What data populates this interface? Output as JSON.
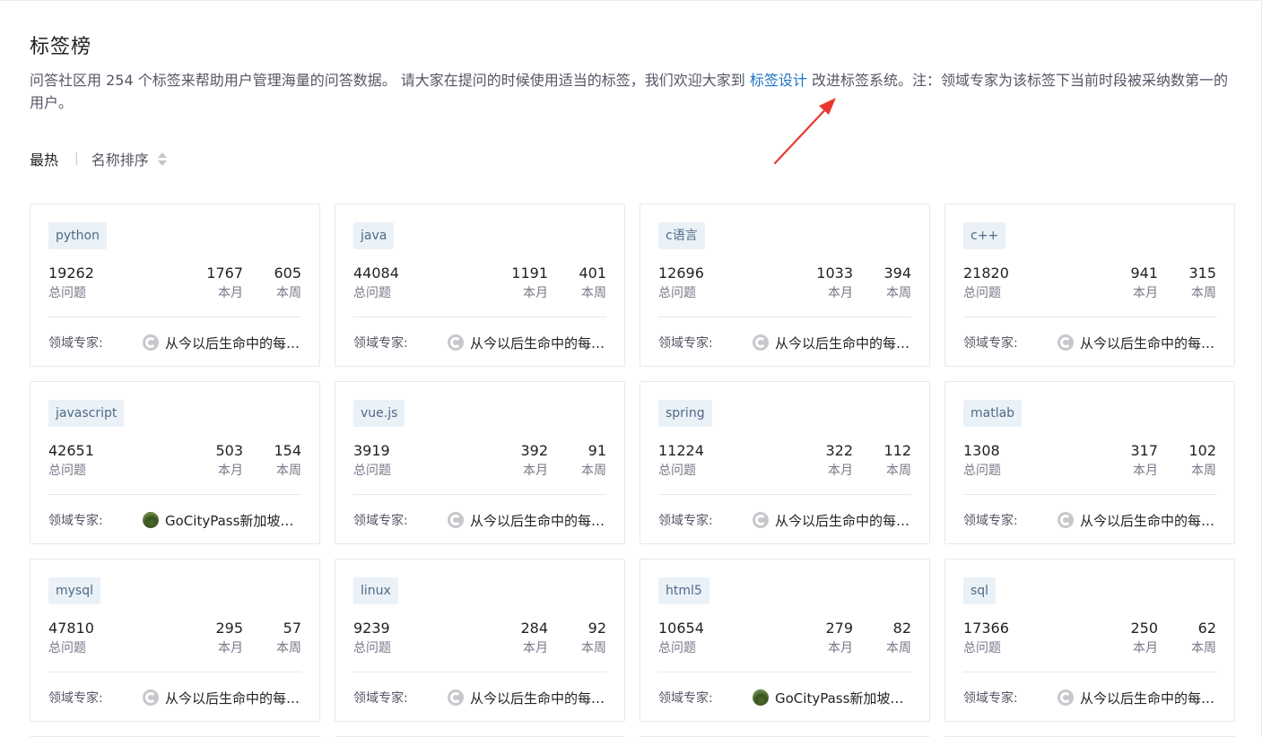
{
  "page": {
    "title": "标签榜",
    "description_before_link": "问答社区用 254 个标签来帮助用户管理海量的问答数据。 请大家在提问的时候使用适当的标签，我们欢迎大家到 ",
    "description_link": "标签设计",
    "description_after_link": " 改进标签系统。注：领域专家为该标签下当前时段被采纳数第一的用户。"
  },
  "sort": {
    "hot_label": "最热",
    "separator": "|",
    "name_label": "名称排序"
  },
  "colors": {
    "link": "#1b74c5",
    "tag_bg": "#eaf1f7",
    "tag_text": "#4e6a87",
    "arrow": "#e8392f"
  },
  "labels": {
    "total": "总问题",
    "month": "本月",
    "week": "本周",
    "expert": "领域专家:"
  },
  "cards": [
    {
      "tag": "python",
      "total": "19262",
      "month": "1767",
      "week": "605",
      "expert": "从今以后生命中的每一天",
      "avatar": "c-icon"
    },
    {
      "tag": "java",
      "total": "44084",
      "month": "1191",
      "week": "401",
      "expert": "从今以后生命中的每一天",
      "avatar": "c-icon"
    },
    {
      "tag": "c语言",
      "total": "12696",
      "month": "1033",
      "week": "394",
      "expert": "从今以后生命中的每一天",
      "avatar": "c-icon"
    },
    {
      "tag": "c++",
      "total": "21820",
      "month": "941",
      "week": "315",
      "expert": "从今以后生命中的每一天",
      "avatar": "c-icon"
    },
    {
      "tag": "javascript",
      "total": "42651",
      "month": "503",
      "week": "154",
      "expert": "GoCityPass新加坡通票",
      "avatar": "green-photo"
    },
    {
      "tag": "vue.js",
      "total": "3919",
      "month": "392",
      "week": "91",
      "expert": "从今以后生命中的每一天",
      "avatar": "c-icon"
    },
    {
      "tag": "spring",
      "total": "11224",
      "month": "322",
      "week": "112",
      "expert": "从今以后生命中的每一天",
      "avatar": "c-icon"
    },
    {
      "tag": "matlab",
      "total": "1308",
      "month": "317",
      "week": "102",
      "expert": "从今以后生命中的每一天",
      "avatar": "c-icon"
    },
    {
      "tag": "mysql",
      "total": "47810",
      "month": "295",
      "week": "57",
      "expert": "从今以后生命中的每一天",
      "avatar": "c-icon"
    },
    {
      "tag": "linux",
      "total": "9239",
      "month": "284",
      "week": "92",
      "expert": "从今以后生命中的每一天",
      "avatar": "c-icon"
    },
    {
      "tag": "html5",
      "total": "10654",
      "month": "279",
      "week": "82",
      "expert": "GoCityPass新加坡通票",
      "avatar": "green-photo"
    },
    {
      "tag": "sql",
      "total": "17366",
      "month": "250",
      "week": "62",
      "expert": "从今以后生命中的每一天",
      "avatar": "c-icon"
    }
  ]
}
